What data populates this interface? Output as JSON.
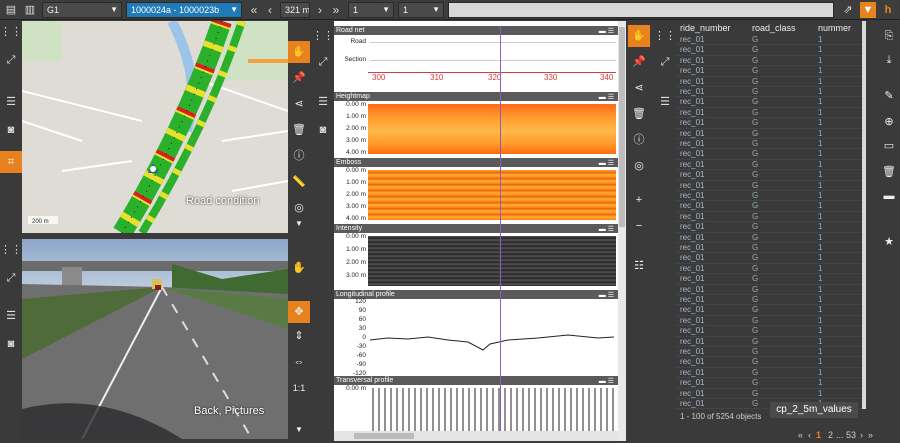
{
  "topbar": {
    "layer": "G1",
    "route": "1000024a - 1000023b",
    "position": "321 m",
    "field_a": "1",
    "field_b": "1"
  },
  "map": {
    "overlay_label": "Road condition",
    "scale": "200 m"
  },
  "camera": {
    "overlay_label": "Back, Pictures"
  },
  "scale_ctrl": {
    "label": "1:1"
  },
  "panels": {
    "road_net": {
      "title": "Road net",
      "rows": [
        "Road",
        "Section"
      ],
      "ticks": [
        "300",
        "310",
        "320",
        "330",
        "340"
      ]
    },
    "heightmap": {
      "title": "Heightmap",
      "ylabels": [
        "0.00 m",
        "1.00 m",
        "2.00 m",
        "3.00 m",
        "4.00 m"
      ]
    },
    "emboss": {
      "title": "Emboss",
      "ylabels": [
        "0.00 m",
        "1.00 m",
        "2.00 m",
        "3.00 m",
        "4.00 m"
      ]
    },
    "intensity": {
      "title": "Intensity",
      "ylabels": [
        "0.00 m",
        "1.00 m",
        "2.00 m",
        "3.00 m"
      ]
    },
    "longitudinal": {
      "title": "Longitudinal profile",
      "ylabels": [
        "120",
        "90",
        "60",
        "30",
        "0",
        "-30",
        "-60",
        "-90",
        "-120"
      ]
    },
    "transversal": {
      "title": "Transversal profile",
      "ylabels": [
        "0.00 m"
      ]
    }
  },
  "table": {
    "columns": [
      "ride_number",
      "road_class",
      "nummer"
    ],
    "rows": [
      [
        "rec_01",
        "G",
        "1"
      ],
      [
        "rec_01",
        "G",
        "1"
      ],
      [
        "rec_01",
        "G",
        "1"
      ],
      [
        "rec_01",
        "G",
        "1"
      ],
      [
        "rec_01",
        "G",
        "1"
      ],
      [
        "rec_01",
        "G",
        "1"
      ],
      [
        "rec_01",
        "G",
        "1"
      ],
      [
        "rec_01",
        "G",
        "1"
      ],
      [
        "rec_01",
        "G",
        "1"
      ],
      [
        "rec_01",
        "G",
        "1"
      ],
      [
        "rec_01",
        "G",
        "1"
      ],
      [
        "rec_01",
        "G",
        "1"
      ],
      [
        "rec_01",
        "G",
        "1"
      ],
      [
        "rec_01",
        "G",
        "1"
      ],
      [
        "rec_01",
        "G",
        "1"
      ],
      [
        "rec_01",
        "G",
        "1"
      ],
      [
        "rec_01",
        "G",
        "1"
      ],
      [
        "rec_01",
        "G",
        "1"
      ],
      [
        "rec_01",
        "G",
        "1"
      ],
      [
        "rec_01",
        "G",
        "1"
      ],
      [
        "rec_01",
        "G",
        "1"
      ],
      [
        "rec_01",
        "G",
        "1"
      ],
      [
        "rec_01",
        "G",
        "1"
      ],
      [
        "rec_01",
        "G",
        "1"
      ],
      [
        "rec_01",
        "G",
        "1"
      ],
      [
        "rec_01",
        "G",
        "1"
      ],
      [
        "rec_01",
        "G",
        "1"
      ],
      [
        "rec_01",
        "G",
        "1"
      ],
      [
        "rec_01",
        "G",
        "1"
      ],
      [
        "rec_01",
        "G",
        "1"
      ],
      [
        "rec_01",
        "G",
        "1"
      ],
      [
        "rec_01",
        "G",
        "1"
      ],
      [
        "rec_01",
        "G",
        "1"
      ],
      [
        "rec_01",
        "G",
        "1"
      ],
      [
        "rec_01",
        "G",
        "1"
      ],
      [
        "rec_01",
        "G",
        "1"
      ]
    ],
    "status": "1 - 100 of 5254 objects",
    "tag": "cp_2_5m_values"
  },
  "pagination": {
    "prev_first": "«",
    "prev": "‹",
    "page1": "1",
    "page2": "2",
    "ellipsis": "...",
    "last": "53",
    "next": "›",
    "next_last": "»"
  }
}
